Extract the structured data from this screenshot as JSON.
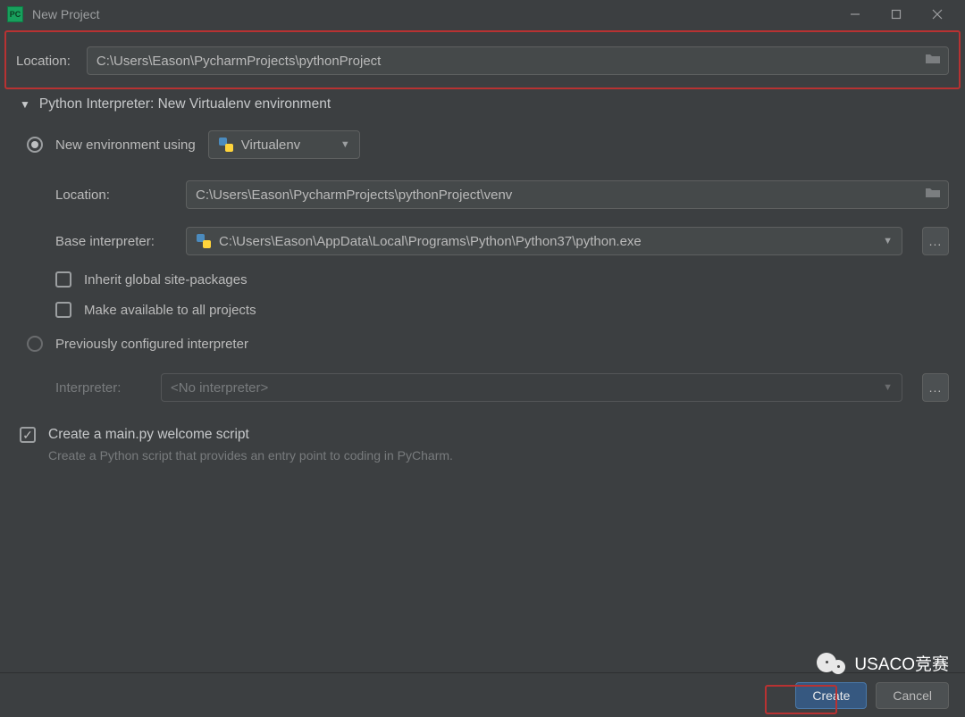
{
  "window": {
    "title": "New Project",
    "app_icon_text": "PC"
  },
  "location": {
    "label": "Location:",
    "value": "C:\\Users\\Eason\\PycharmProjects\\pythonProject"
  },
  "interpreter_section": {
    "header": "Python Interpreter: New Virtualenv environment",
    "new_env": {
      "label": "New environment using",
      "dropdown": "Virtualenv",
      "location_label": "Location:",
      "location_value": "C:\\Users\\Eason\\PycharmProjects\\pythonProject\\venv",
      "base_label": "Base interpreter:",
      "base_value": "C:\\Users\\Eason\\AppData\\Local\\Programs\\Python\\Python37\\python.exe",
      "inherit_label": "Inherit global site-packages",
      "make_avail_label": "Make available to all projects"
    },
    "prev_config": {
      "label": "Previously configured interpreter",
      "interpreter_label": "Interpreter:",
      "interpreter_value": "<No interpreter>"
    }
  },
  "welcome": {
    "label": "Create a main.py welcome script",
    "sub": "Create a Python script that provides an entry point to coding in PyCharm."
  },
  "buttons": {
    "create": "Create",
    "cancel": "Cancel",
    "ellipsis": "..."
  },
  "watermark": "USACO竞赛"
}
